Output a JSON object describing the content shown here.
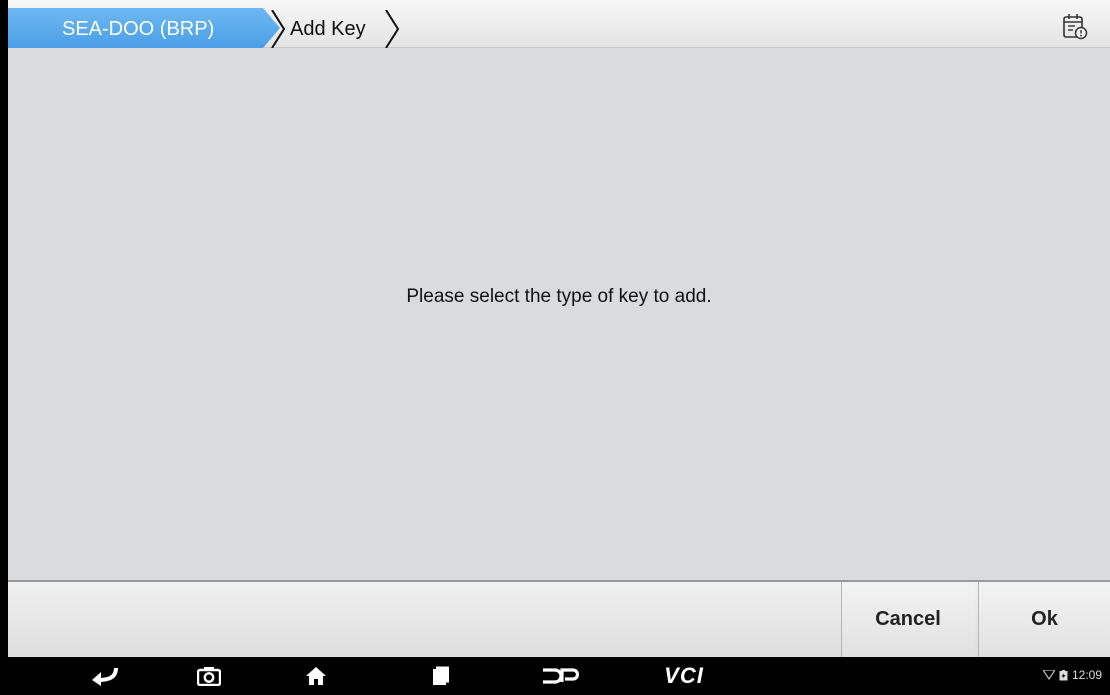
{
  "header": {
    "breadcrumbs": [
      {
        "label": "SEA-DOO (BRP)"
      },
      {
        "label": "Add Key"
      }
    ],
    "report_icon": "calendar-report-icon"
  },
  "main": {
    "message": "Please select the type of key to add."
  },
  "footer": {
    "cancel_label": "Cancel",
    "ok_label": "Ok"
  },
  "navbar": {
    "items": [
      "back-icon",
      "camera-icon",
      "home-icon",
      "recent-apps-icon",
      "dp-icon",
      "vci-icon"
    ],
    "vci_label": "VCI",
    "dp_label": "DP",
    "time": "12:09"
  },
  "colors": {
    "breadcrumb_active": "#4a9fe6",
    "background": "#d9dcdf"
  }
}
